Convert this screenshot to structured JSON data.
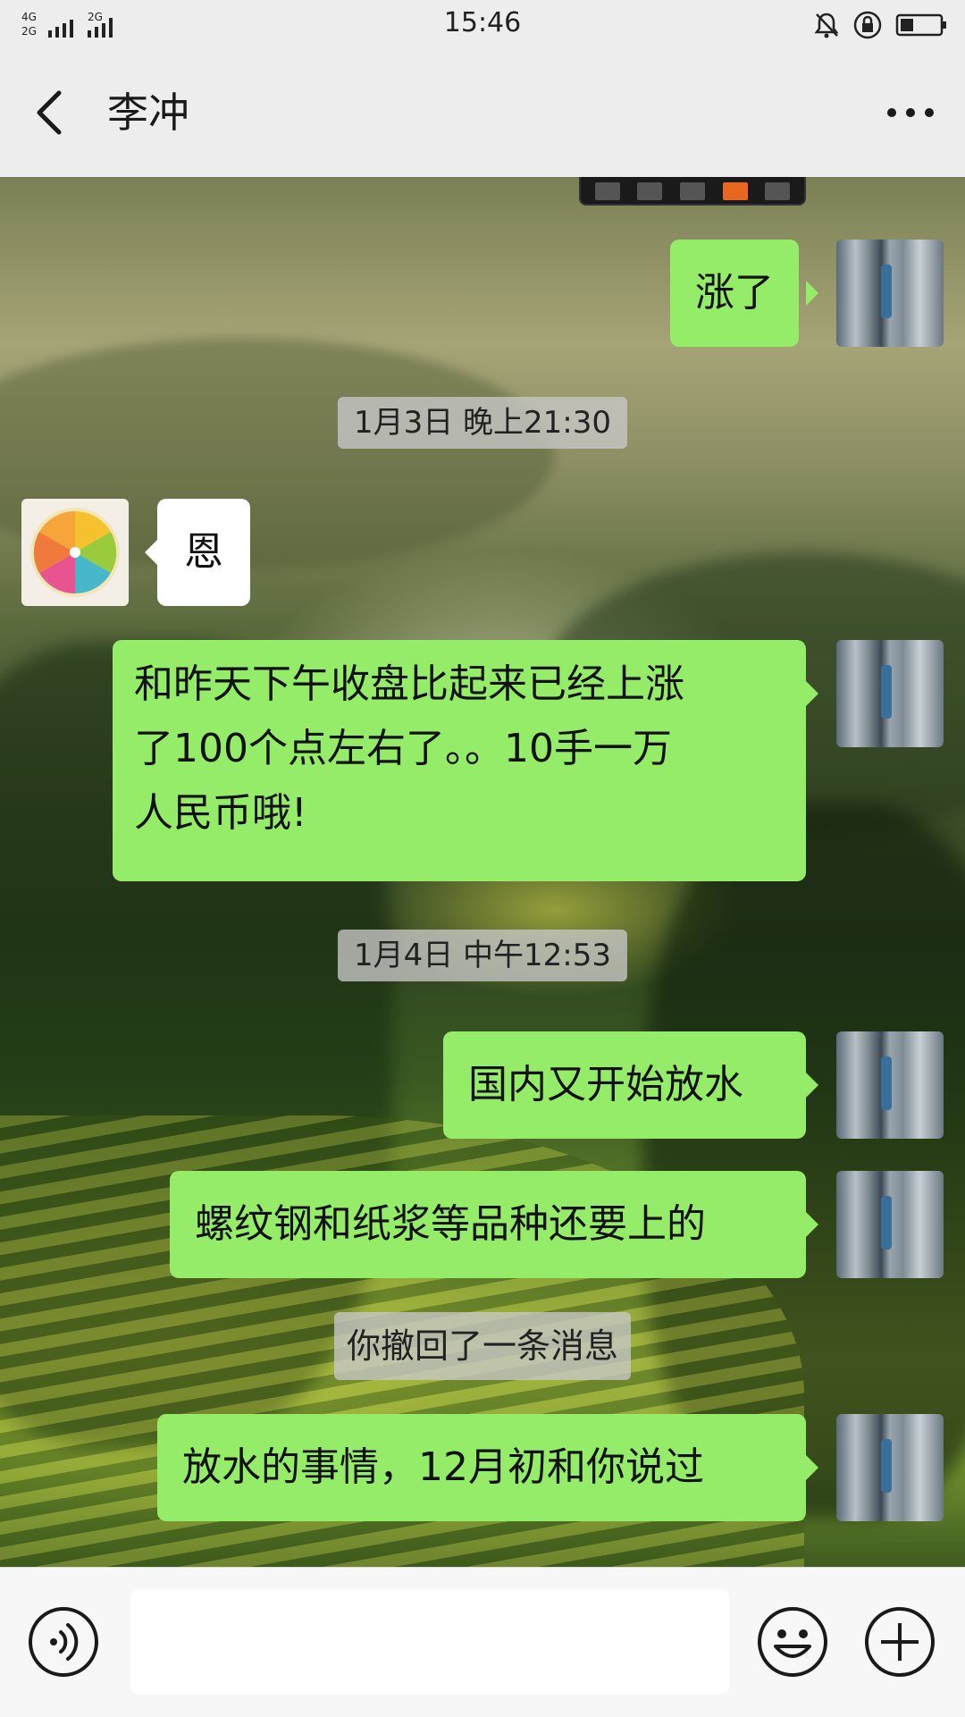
{
  "status_bar": {
    "time": "15:46",
    "network_1": "4G",
    "network_2": "2G",
    "network_3": "2G"
  },
  "header": {
    "title": "李冲",
    "back_icon": "chevron-left-icon",
    "more_icon": "more-dots-icon"
  },
  "messages": [
    {
      "type": "image",
      "sender": "self"
    },
    {
      "type": "text",
      "sender": "self",
      "text": "涨了"
    },
    {
      "type": "time",
      "text": "1月3日 晚上21:30"
    },
    {
      "type": "text",
      "sender": "contact",
      "text": "恩"
    },
    {
      "type": "text",
      "sender": "self",
      "lines": [
        "和昨天下午收盘比起来已经上涨",
        "了100个点左右了。。10手一万",
        "人民币哦!"
      ]
    },
    {
      "type": "time",
      "text": "1月4日 中午12:53"
    },
    {
      "type": "text",
      "sender": "self",
      "text": "国内又开始放水"
    },
    {
      "type": "text",
      "sender": "self",
      "text": "螺纹钢和纸浆等品种还要上的"
    },
    {
      "type": "system",
      "text": "你撤回了一条消息"
    },
    {
      "type": "text",
      "sender": "self",
      "text": "放水的事情，12月初和你说过"
    }
  ],
  "input_bar": {
    "placeholder": "",
    "voice_icon": "voice-icon",
    "emoji_icon": "emoji-icon",
    "plus_icon": "plus-icon"
  },
  "colors": {
    "self_bubble": "#95ec69",
    "other_bubble": "#ffffff",
    "header_bg": "#ededed"
  }
}
